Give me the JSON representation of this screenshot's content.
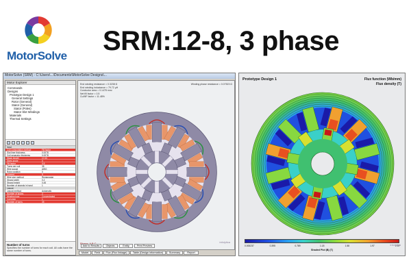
{
  "slide": {
    "logo_text": "MotorSolve",
    "title": "SRM:12-8, 3 phase"
  },
  "app": {
    "title": "MotorSolve (SRM) - C:\\Users\\...\\Documents\\MotorSolve Designs\\...",
    "explorer_title": "Motor Explorer",
    "tree": [
      "Commands",
      "Designs",
      "Prototype Design 1",
      "General Settings",
      "Rotor (General)",
      "Stator (General)",
      "Stator (Poles)",
      "Stator Slot Windings",
      "Materials",
      "Thermal Settings"
    ],
    "props": [
      {
        "name": "Input",
        "value": "",
        "style": "head"
      },
      {
        "name": "Coil computation method",
        "value": "Fill factor",
        "style": "red"
      },
      {
        "name": "Slot liner thickness",
        "value": "0.0078",
        "style": ""
      },
      {
        "name": "Coil separator thickness",
        "value": "0.0078",
        "style": ""
      },
      {
        "name": "Stack length",
        "value": "17.00",
        "style": "red"
      },
      {
        "name": "Skew angle",
        "value": "0",
        "style": "red"
      },
      {
        "name": "Fill factor",
        "value": "0.5",
        "style": "red"
      },
      {
        "name": "Turns per coil",
        "value": "35",
        "style": ""
      },
      {
        "name": "Wire gauge",
        "value": "AWG",
        "style": ""
      },
      {
        "name": "Rotor position",
        "value": "0",
        "style": ""
      },
      {
        "name": "Current",
        "value": "5",
        "style": "red"
      },
      {
        "name": "Wire size method",
        "value": "Rectangular",
        "style": ""
      },
      {
        "name": "Strand width",
        "value": "0.2",
        "style": ""
      },
      {
        "name": "Strand height",
        "value": "0.45",
        "style": ""
      },
      {
        "name": "Number of strands in hand",
        "value": "1",
        "style": ""
      },
      {
        "name": "Layout",
        "value": "",
        "style": "head"
      },
      {
        "name": "Layout method",
        "value": "Automatic",
        "style": ""
      },
      {
        "name": "Number of layers",
        "value": "2",
        "style": "red"
      },
      {
        "name": "Winding type",
        "value": "Concentrated",
        "style": "red"
      },
      {
        "name": "Coil pitch",
        "value": "1",
        "style": "red"
      },
      {
        "name": "Number of turns",
        "value": "35",
        "style": "red"
      }
    ],
    "props_footer_title": "Number of turns",
    "props_footer_desc": "Specifies the number of turns for each coil. All coils have the same number of turns.",
    "canvas_info": [
      "End winding resistance = 0.3238 Ω",
      "End winding inductance = 79.72 μH",
      "Conductor area = 0.1478 mm²",
      "Net fill factor = 0.5",
      "Cu/MF factor = 11.48%"
    ],
    "canvas_info_right": "Winding phase resistance = 0.07523 Ω",
    "phase_label": "Phase: A  B  C",
    "watermark": "infolytica",
    "view_buttons": [
      "Add to Results",
      "Objects",
      "Entity",
      "Print Preview"
    ],
    "bottom_tabs": [
      "Model",
      "Field",
      "Flux (Flux linkage)",
      "Table (Design information)",
      "Summary",
      "Report"
    ]
  },
  "plot": {
    "title": "Prototype Design 1",
    "flux_function": "Flux function (Wb/mm)",
    "flux_density": "Flux density (T)",
    "colorbar_ticks": [
      "0.000237",
      "0.395",
      "0.789",
      "1.18",
      "1.58",
      "1.97",
      "2.37"
    ],
    "colorbar_caption": "Shaded Plot |B| (T)",
    "watermark": "infolytica"
  },
  "colors": {
    "stator": "#8f8aa6",
    "teeth": "#e8966a",
    "flux_high": "#e85020",
    "flux_low": "#2050e0"
  }
}
